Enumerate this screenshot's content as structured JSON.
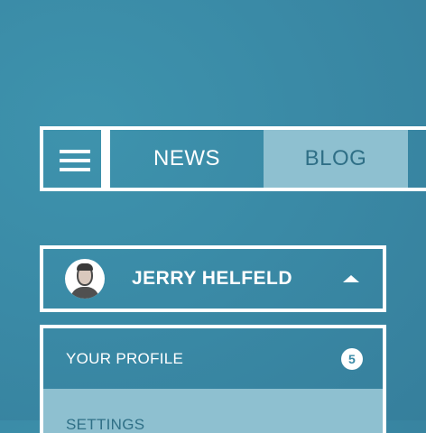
{
  "nav": {
    "menu_icon": "hamburger-icon",
    "tabs": [
      {
        "label": "NEWS",
        "active": false
      },
      {
        "label": "BLOG",
        "active": true
      }
    ]
  },
  "user": {
    "name": "JERRY HELFELD",
    "avatar_icon": "avatar-photo",
    "caret_icon": "caret-up-icon"
  },
  "menu": {
    "items": [
      {
        "label": "YOUR PROFILE",
        "badge": "5"
      },
      {
        "label": "SETTINGS"
      }
    ]
  },
  "colors": {
    "background": "#3a8aa6",
    "border": "#ffffff",
    "active_tab": "#8ec0d0",
    "active_text": "#2f6f86"
  }
}
